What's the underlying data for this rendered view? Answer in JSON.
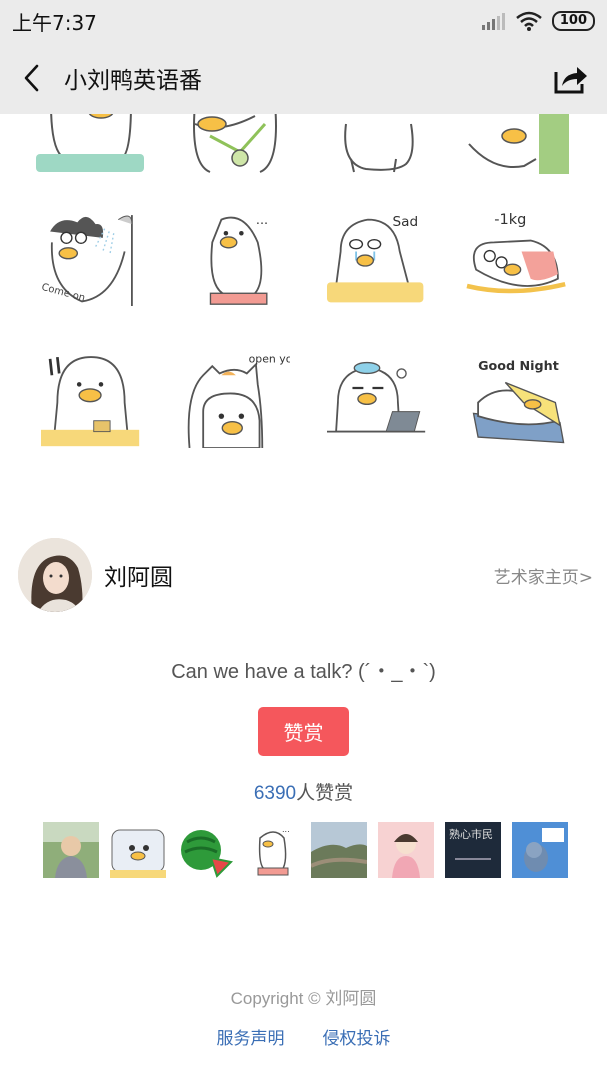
{
  "status_bar": {
    "time": "上午7:37",
    "battery": "100"
  },
  "nav": {
    "title": "小刘鸭英语番"
  },
  "stickers": [
    {
      "text": ""
    },
    {
      "text": ""
    },
    {
      "text": ""
    },
    {
      "text": ""
    },
    {
      "text": "Come on"
    },
    {
      "text": "..."
    },
    {
      "text": "Sad"
    },
    {
      "text": "-1kg"
    },
    {
      "text": ""
    },
    {
      "text": "open your eyes"
    },
    {
      "text": ""
    },
    {
      "text": "Good Night"
    }
  ],
  "artist": {
    "name": "刘阿圆",
    "link": "艺术家主页"
  },
  "message": "Can we have a talk? (´・_・`)",
  "reward": {
    "button": "赞赏",
    "count": "6390",
    "count_suffix": "人赞赏"
  },
  "supporters": [
    {
      "icon": "monk-photo-icon"
    },
    {
      "icon": "duck-pillow-icon"
    },
    {
      "icon": "watermelon-icon"
    },
    {
      "icon": "duck-scale-icon"
    },
    {
      "icon": "great-wall-icon"
    },
    {
      "icon": "girl-illustration-icon"
    },
    {
      "icon": "book-cover-icon",
      "text": "熟心市民"
    },
    {
      "icon": "tom-jerry-icon"
    }
  ],
  "footer": {
    "copyright": "Copyright © 刘阿圆",
    "links": [
      "服务声明",
      "侵权投诉"
    ]
  },
  "colors": {
    "accent": "#f5575c",
    "link": "#3a6eb5",
    "header_bg": "#ebebeb"
  }
}
